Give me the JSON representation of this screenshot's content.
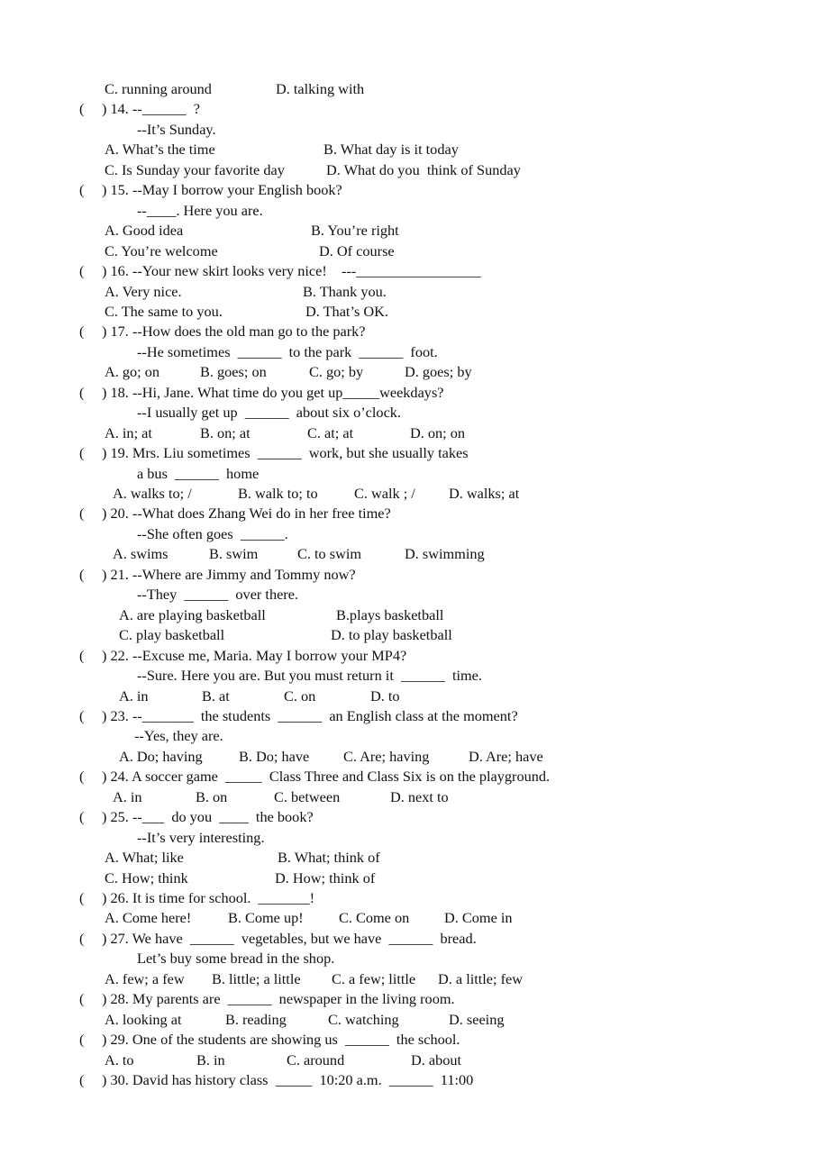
{
  "document": {
    "lines": [
      {
        "kind": "opts",
        "segs": [
          "C. running around",
          "D. talking with"
        ]
      },
      {
        "kind": "q",
        "num": "14.",
        "text": "--______  ?"
      },
      {
        "kind": "ans",
        "text": "--It’s Sunday."
      },
      {
        "kind": "opts",
        "segs": [
          "A. What’s the time",
          "B. What day is it today"
        ]
      },
      {
        "kind": "opts",
        "segs": [
          "C. Is Sunday your favorite day",
          "D. What do you  think of Sunday"
        ]
      },
      {
        "kind": "q",
        "num": "15.",
        "text": "--May I borrow your English book?"
      },
      {
        "kind": "ans",
        "text": "--____. Here you are."
      },
      {
        "kind": "opts",
        "segs": [
          "A. Good idea",
          "B. You’re right"
        ]
      },
      {
        "kind": "opts",
        "segs": [
          "C. You’re welcome",
          "D. Of course"
        ]
      },
      {
        "kind": "q",
        "num": "16.",
        "text": "--Your new skirt looks very nice!    ---_________________"
      },
      {
        "kind": "opts",
        "segs": [
          "A. Very nice.",
          "B. Thank you."
        ]
      },
      {
        "kind": "opts",
        "segs": [
          "C. The same to you.",
          "D. That’s OK."
        ]
      },
      {
        "kind": "q",
        "num": "17.",
        "text": "--How does the old man go to the park?"
      },
      {
        "kind": "ans",
        "text": "--He sometimes  ______  to the park  ______  foot."
      },
      {
        "kind": "opts",
        "segs": [
          "A. go; on",
          "B. goes; on",
          "C. go; by",
          "D. goes; by"
        ]
      },
      {
        "kind": "q",
        "num": "18.",
        "text": "--Hi, Jane. What time do you get up_____weekdays?"
      },
      {
        "kind": "ans",
        "text": "--I usually get up  ______  about six o’clock."
      },
      {
        "kind": "opts",
        "segs": [
          "A. in; at",
          "B. on; at",
          "C. at; at",
          "D. on; on"
        ]
      },
      {
        "kind": "q",
        "num": "19.",
        "text": "Mrs. Liu sometimes  ______  work, but she usually takes"
      },
      {
        "kind": "ans",
        "text": "a bus  ______  home"
      },
      {
        "kind": "opts2",
        "segs": [
          "A. walks to; /",
          "B. walk to; to",
          "C. walk ; /",
          "D. walks; at"
        ]
      },
      {
        "kind": "q",
        "num": "20.",
        "text": "--What does Zhang Wei do in her free time?"
      },
      {
        "kind": "ans",
        "text": "--She often goes  ______."
      },
      {
        "kind": "opts2",
        "segs": [
          "A. swims",
          "B. swim",
          "C. to swim",
          "D. swimming"
        ]
      },
      {
        "kind": "q",
        "num": "21.",
        "text": "--Where are Jimmy and Tommy now?"
      },
      {
        "kind": "ans",
        "text": "--They  ______  over there."
      },
      {
        "kind": "opts3",
        "segs": [
          "A. are playing basketball",
          "B.plays basketball"
        ]
      },
      {
        "kind": "opts3",
        "segs": [
          "C. play basketball",
          "D. to play basketball"
        ]
      },
      {
        "kind": "q",
        "num": "22.",
        "text": "--Excuse me, Maria. May I borrow your MP4?"
      },
      {
        "kind": "ans",
        "text": "--Sure. Here you are. But you must return it  ______  time."
      },
      {
        "kind": "opts3",
        "segs": [
          "A. in",
          "B. at",
          "C. on",
          "D. to"
        ]
      },
      {
        "kind": "q",
        "num": "23.",
        "text": "--_______  the students  ______  an English class at the moment?"
      },
      {
        "kind": "ans2",
        "text": "--Yes, they are."
      },
      {
        "kind": "opts3",
        "segs": [
          "A. Do; having",
          "B. Do; have",
          "C. Are; having",
          "D. Are; have"
        ]
      },
      {
        "kind": "q",
        "num": "24.",
        "text": "A soccer game  _____  Class Three and Class Six is on the playground."
      },
      {
        "kind": "opts2",
        "segs": [
          "A. in",
          "B. on",
          "C. between",
          "D. next to"
        ]
      },
      {
        "kind": "q",
        "num": "25.",
        "text": "--___  do you  ____  the book?"
      },
      {
        "kind": "ans",
        "text": "--It’s very interesting."
      },
      {
        "kind": "opts",
        "segs": [
          "A. What; like",
          "B. What; think of"
        ]
      },
      {
        "kind": "opts",
        "segs": [
          "C. How; think",
          "D. How; think of"
        ]
      },
      {
        "kind": "q",
        "num": "26.",
        "text": "It is time for school.  _______!"
      },
      {
        "kind": "opts",
        "segs": [
          "A. Come here!",
          "B. Come up!",
          "C. Come on",
          "D. Come in"
        ]
      },
      {
        "kind": "q",
        "num": "27.",
        "text": "We have  ______  vegetables, but we have  ______  bread."
      },
      {
        "kind": "ans",
        "text": "Let’s buy some bread in the shop."
      },
      {
        "kind": "opts",
        "segs": [
          "A. few; a few",
          "B. little; a little",
          "C. a few; little",
          "D. a little; few"
        ]
      },
      {
        "kind": "q",
        "num": "28.",
        "text": "My parents are  ______  newspaper in the living room."
      },
      {
        "kind": "opts",
        "segs": [
          "A. looking at",
          "B. reading",
          "C. watching",
          "D. seeing"
        ]
      },
      {
        "kind": "q",
        "num": "29.",
        "text": "One of the students are showing us  ______  the school."
      },
      {
        "kind": "opts",
        "segs": [
          "A. to",
          "B. in",
          "C. around",
          "D. about"
        ]
      },
      {
        "kind": "q",
        "num": "30.",
        "text": "David has history class  _____  10:20 a.m.  ______  11:00"
      }
    ]
  }
}
